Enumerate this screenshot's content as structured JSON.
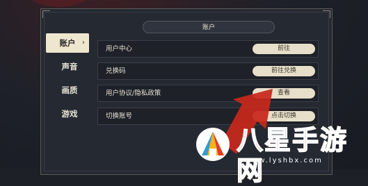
{
  "panel": {
    "header": "账户"
  },
  "sidebar": {
    "items": [
      {
        "label": "账户",
        "active": true,
        "chevron": "›"
      },
      {
        "label": "声音",
        "active": false
      },
      {
        "label": "画质",
        "active": false
      },
      {
        "label": "游戏",
        "active": false
      }
    ]
  },
  "rows": [
    {
      "label": "用户中心",
      "button": "前往"
    },
    {
      "label": "兑换码",
      "button": "前往兑换"
    },
    {
      "label": "用户协议/隐私政策",
      "button": "查看"
    },
    {
      "label": "切换账号",
      "button": "点击切换"
    }
  ],
  "watermark": {
    "title": "八星手游网",
    "url": "www.lyshbx.com"
  },
  "colors": {
    "accent_cream": "#efe6cf",
    "arrow_red": "#c7281c",
    "watermark_red": "#e23b2e"
  }
}
